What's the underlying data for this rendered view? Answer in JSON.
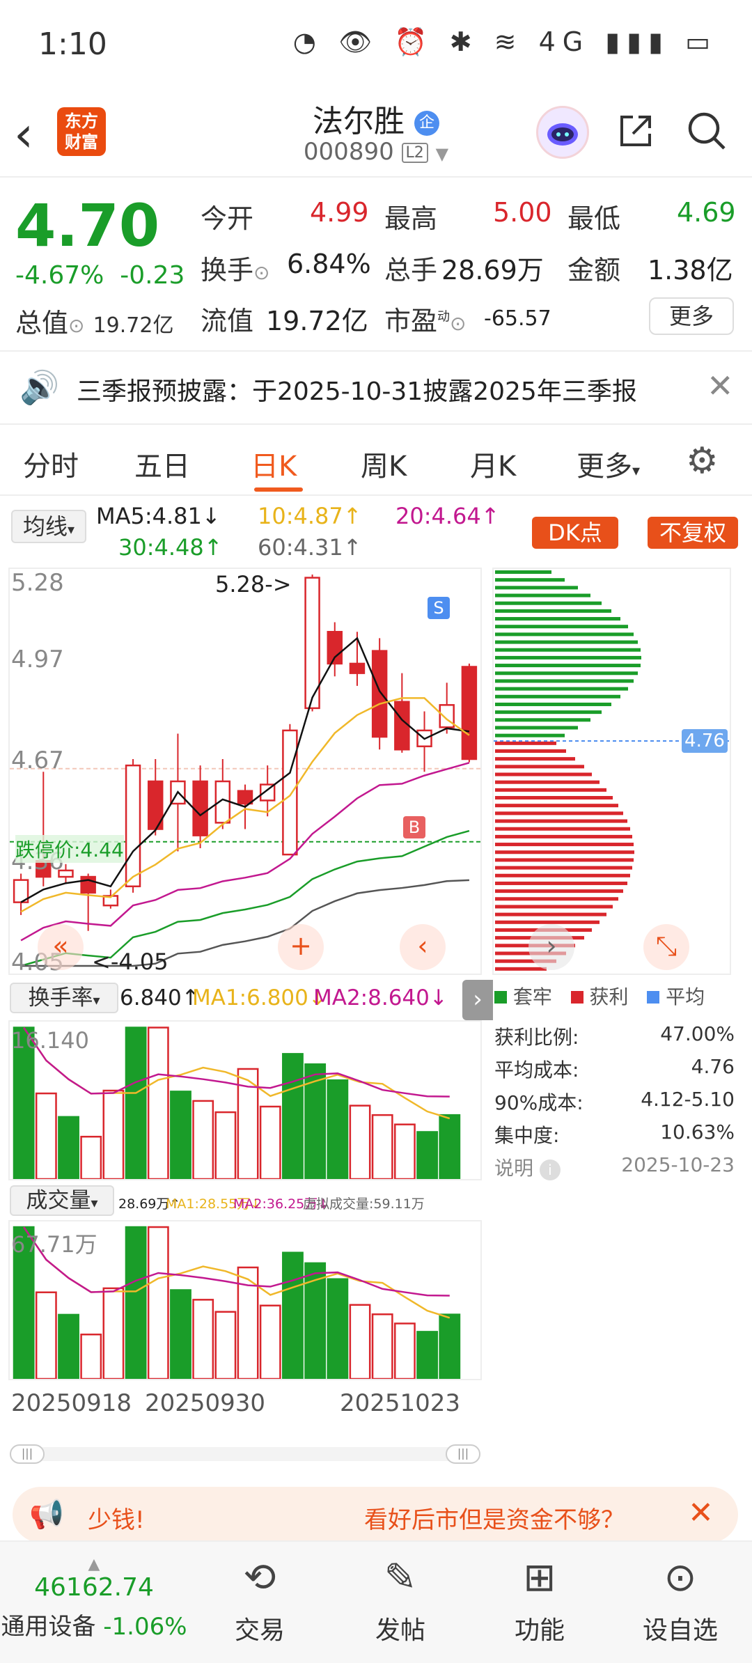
{
  "status": {
    "time": "1:10",
    "icons": "◔ 👁 ⏰ ✱ ≋ 4G ▮▮▮ ▭"
  },
  "header": {
    "stock_name": "法尔胜",
    "badge": "企",
    "code": "000890",
    "level": "L2",
    "logo_line1": "东方",
    "logo_line2": "财富"
  },
  "quote": {
    "price": "4.70",
    "change_pct": "-4.67%",
    "change": "-0.23",
    "open_label": "今开",
    "open": "4.99",
    "high_label": "最高",
    "high": "5.00",
    "low_label": "最低",
    "low": "4.69",
    "turnover_label": "换手",
    "turnover": "6.84%",
    "volume_label": "总手",
    "volume": "28.69万",
    "amount_label": "金额",
    "amount": "1.38亿",
    "mcap_label": "总值",
    "mcap": "19.72亿",
    "float_label": "流值",
    "float": "19.72亿",
    "pe_label": "市盈",
    "pe_sup": "动",
    "pe": "-65.57",
    "more": "更多"
  },
  "notice": {
    "text": "三季报预披露：于2025-10-31披露2025年三季报"
  },
  "tabs": [
    "分时",
    "五日",
    "日K",
    "周K",
    "月K",
    "更多"
  ],
  "ma": {
    "selector": "均线",
    "ma5": "MA5:4.81↓",
    "ma10": "10:4.87↑",
    "ma20": "20:4.64↑",
    "ma30": "30:4.48↑",
    "ma60": "60:4.31↑",
    "dk": "DK点",
    "fq": "不复权"
  },
  "kchart": {
    "y_labels": [
      "5.28",
      "4.97",
      "4.67",
      "4.36",
      "4.05"
    ],
    "high_note": "5.28->",
    "low_note": "<-4.05",
    "limit_down": "跌停价:4.44",
    "s_mark": "S",
    "b_mark": "B"
  },
  "chips": {
    "avg_label": "4.76",
    "legend": [
      "套牢",
      "获利",
      "平均"
    ],
    "rows": [
      {
        "k": "获利比例:",
        "v": "47.00%"
      },
      {
        "k": "平均成本:",
        "v": "4.76"
      },
      {
        "k": "90%成本:",
        "v": "4.12-5.10"
      },
      {
        "k": "集中度:",
        "v": "10.63%"
      }
    ],
    "note": "说明",
    "date": "2025-10-23"
  },
  "turnover_ind": {
    "selector": "换手率",
    "val": "6.840↑",
    "ma1": "MA1:6.800↓",
    "ma2": "MA2:8.640↓",
    "ylabel": "16.140"
  },
  "volume_ind": {
    "selector": "成交量",
    "val": "28.69万↑",
    "ma1": "MA1:28.55万↓",
    "ma2": "MA2:36.25万↓",
    "virtual": "虚拟成交量:59.11万",
    "ylabel": "67.71万"
  },
  "dates": [
    "20250918",
    "20250930",
    "20251023"
  ],
  "banner": {
    "left": "少钱!",
    "right": "看好后市但是资金不够？"
  },
  "bottom": {
    "index_value": "46162.74",
    "index_name": "通用设备",
    "index_chg": "-1.06%",
    "items": [
      "交易",
      "发帖",
      "功能",
      "设自选"
    ]
  },
  "colors": {
    "up": "#d9262c",
    "down": "#1a9d29",
    "accent": "#e8501a"
  },
  "chart_data": {
    "type": "candlestick",
    "candles": [
      {
        "o": 4.32,
        "c": 4.25,
        "h": 4.34,
        "l": 4.21,
        "up": true
      },
      {
        "o": 4.38,
        "c": 4.33,
        "h": 4.66,
        "l": 4.3,
        "up": false
      },
      {
        "o": 4.33,
        "c": 4.35,
        "h": 4.37,
        "l": 4.31,
        "up": true
      },
      {
        "o": 4.33,
        "c": 4.28,
        "h": 4.34,
        "l": 4.16,
        "up": false
      },
      {
        "o": 4.24,
        "c": 4.27,
        "h": 4.29,
        "l": 4.23,
        "up": true
      },
      {
        "o": 4.3,
        "c": 4.68,
        "h": 4.7,
        "l": 4.28,
        "up": true
      },
      {
        "o": 4.63,
        "c": 4.48,
        "h": 4.7,
        "l": 4.46,
        "up": false
      },
      {
        "o": 4.56,
        "c": 4.63,
        "h": 4.78,
        "l": 4.41,
        "up": true
      },
      {
        "o": 4.63,
        "c": 4.46,
        "h": 4.68,
        "l": 4.42,
        "up": false
      },
      {
        "o": 4.5,
        "c": 4.63,
        "h": 4.7,
        "l": 4.48,
        "up": true
      },
      {
        "o": 4.6,
        "c": 4.56,
        "h": 4.62,
        "l": 4.48,
        "up": false
      },
      {
        "o": 4.57,
        "c": 4.62,
        "h": 4.68,
        "l": 4.52,
        "up": true
      },
      {
        "o": 4.4,
        "c": 4.79,
        "h": 4.81,
        "l": 4.4,
        "up": true
      },
      {
        "o": 4.86,
        "c": 5.27,
        "h": 5.28,
        "l": 4.85,
        "up": true
      },
      {
        "o": 5.1,
        "c": 5.0,
        "h": 5.13,
        "l": 4.96,
        "up": false
      },
      {
        "o": 5.0,
        "c": 4.97,
        "h": 5.1,
        "l": 4.93,
        "up": false
      },
      {
        "o": 5.04,
        "c": 4.77,
        "h": 5.08,
        "l": 4.73,
        "up": false
      },
      {
        "o": 4.88,
        "c": 4.73,
        "h": 4.97,
        "l": 4.72,
        "up": false
      },
      {
        "o": 4.74,
        "c": 4.79,
        "h": 4.85,
        "l": 4.66,
        "up": true
      },
      {
        "o": 4.8,
        "c": 4.87,
        "h": 4.94,
        "l": 4.78,
        "up": true
      },
      {
        "o": 4.99,
        "c": 4.7,
        "h": 5.0,
        "l": 4.69,
        "up": false
      }
    ],
    "ylim": [
      4.05,
      5.28
    ],
    "turnover": [
      16.1,
      9.1,
      6.6,
      4.5,
      9.4,
      16.1,
      16.1,
      9.3,
      8.3,
      7.1,
      11.7,
      7.7,
      13.3,
      12.2,
      10.5,
      7.8,
      6.8,
      5.8,
      5.0,
      6.8
    ],
    "turnover_up": [
      false,
      true,
      false,
      true,
      true,
      false,
      true,
      false,
      true,
      true,
      true,
      true,
      false,
      false,
      false,
      true,
      true,
      true,
      false,
      false
    ],
    "volume": [
      67.7,
      38.6,
      28.6,
      19.8,
      40.4,
      67.7,
      67.7,
      39.6,
      35.3,
      29.9,
      49.7,
      32.7,
      56.3,
      51.6,
      44.5,
      33.0,
      28.8,
      24.7,
      21.0,
      28.7
    ],
    "volume_up": [
      false,
      true,
      false,
      true,
      true,
      false,
      true,
      false,
      true,
      true,
      true,
      true,
      false,
      false,
      false,
      true,
      true,
      true,
      false,
      false
    ],
    "chips_green": 22,
    "chips_red": 30
  }
}
